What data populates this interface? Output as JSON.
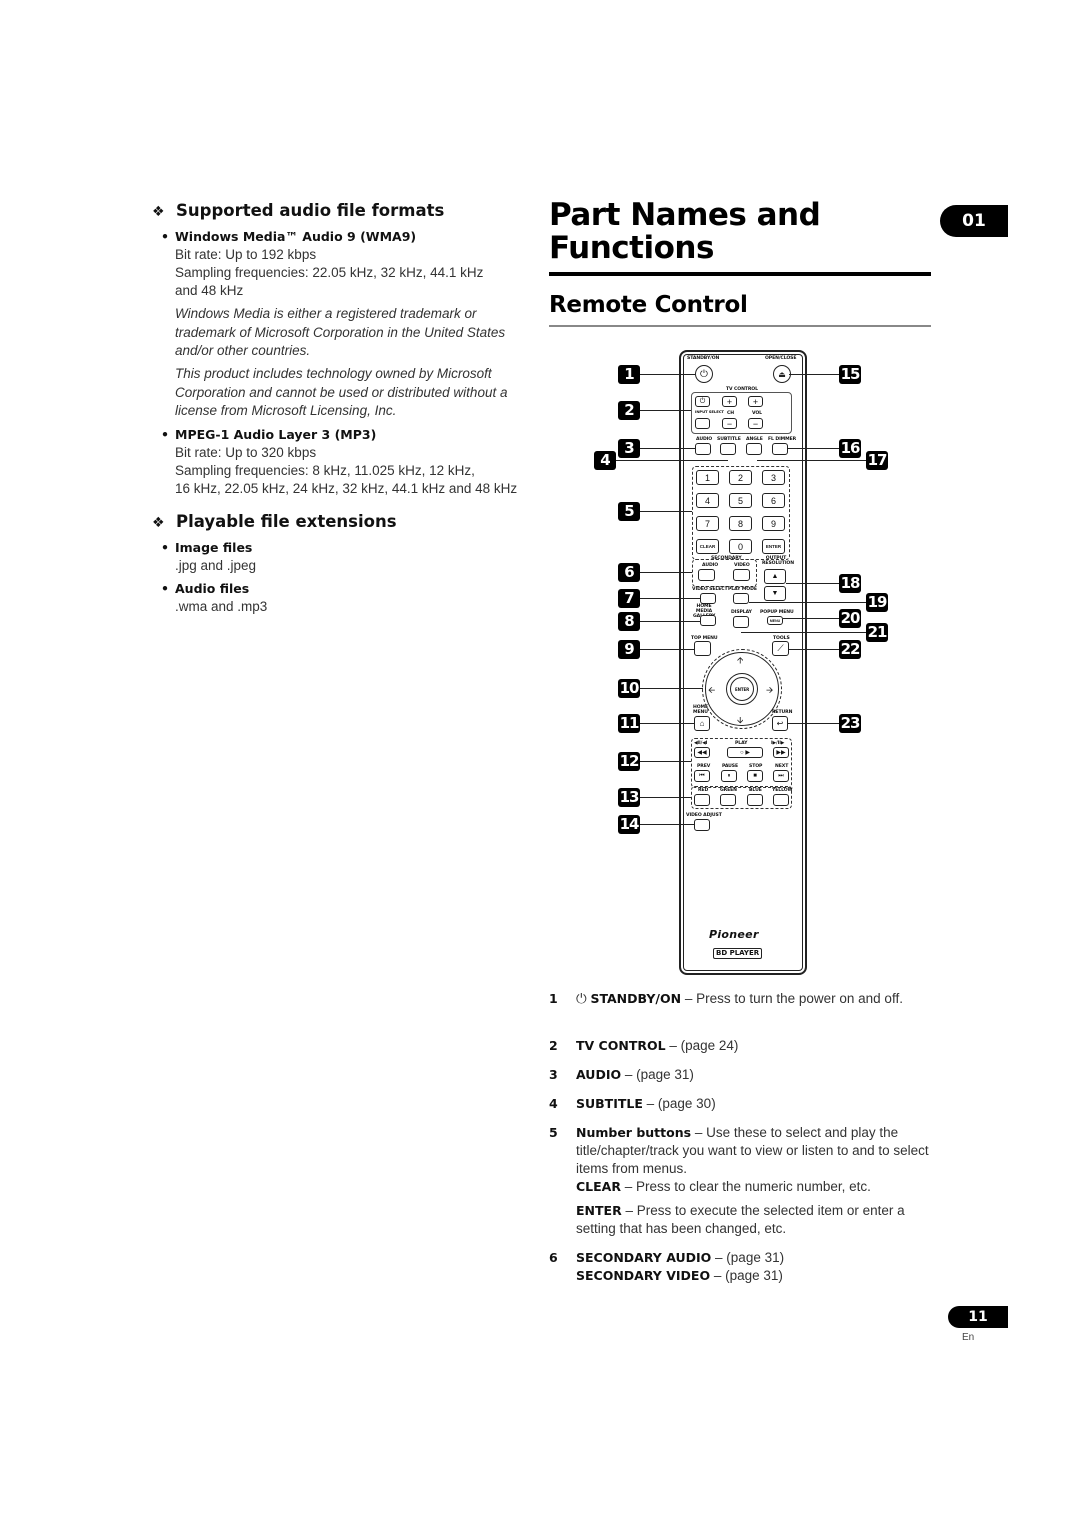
{
  "left": {
    "section1": {
      "heading": "Supported audio file formats",
      "items": [
        {
          "title": "Windows Media™ Audio 9 (WMA9)",
          "lines": [
            "Bit rate: Up to 192 kbps",
            "Sampling frequencies: 22.05 kHz, 32 kHz, 44.1 kHz",
            "and 48 kHz"
          ],
          "notes": [
            "Windows Media is either a registered trademark or trademark of Microsoft Corporation in the United States and/or other countries.",
            "This product includes technology owned by Microsoft Corporation and cannot be used or distributed without a license from Microsoft Licensing, Inc."
          ]
        },
        {
          "title": "MPEG-1 Audio Layer 3 (MP3)",
          "lines": [
            "Bit rate: Up to 320 kbps",
            "Sampling frequencies: 8 kHz, 11.025 kHz, 12 kHz,",
            "16 kHz, 22.05 kHz, 24 kHz, 32 kHz, 44.1 kHz and 48 kHz"
          ]
        }
      ]
    },
    "section2": {
      "heading": "Playable file extensions",
      "items": [
        {
          "title": "Image files",
          "value": ".jpg and .jpeg"
        },
        {
          "title": "Audio files",
          "value": ".wma and .mp3"
        }
      ]
    }
  },
  "right": {
    "title_line1": "Part Names and",
    "title_line2": "Functions",
    "chapter": "01",
    "section": "Remote Control"
  },
  "remote": {
    "labels": {
      "standby": "STANDBY/ON",
      "open_close": "OPEN/CLOSE",
      "tv_control": "TV CONTROL",
      "input_select": "INPUT SELECT",
      "ch": "CH",
      "vol": "VOL",
      "audio": "AUDIO",
      "subtitle": "SUBTITLE",
      "angle": "ANGLE",
      "fl_dimmer": "FL DIMMER",
      "secondary": "SECONDARY",
      "sec_audio": "AUDIO",
      "sec_video": "VIDEO",
      "output_resolution": "OUTPUT RESOLUTION",
      "video_select": "VIDEO SELECT",
      "play_mode": "PLAY MODE",
      "home_media_gallery": "HOME MEDIA GALLERY",
      "display": "DISPLAY",
      "popup_menu": "POPUP MENU",
      "menu": "MENU",
      "top_menu": "TOP MENU",
      "tools": "TOOLS",
      "enter": "ENTER",
      "home_menu": "HOME MENU",
      "return": "RETURN",
      "rev": "◀II/◀I",
      "play": "PLAY",
      "fwd": "I▶/II▶",
      "prev": "PREV",
      "pause": "PAUSE",
      "stop": "STOP",
      "next": "NEXT",
      "red": "RED",
      "green": "GREEN",
      "blue": "BLUE",
      "yellow": "YELLOW",
      "video_adjust": "VIDEO ADJUST",
      "brand": "Pioneer",
      "model": "BD PLAYER"
    },
    "numpad": [
      "1",
      "2",
      "3",
      "4",
      "5",
      "6",
      "7",
      "8",
      "9",
      "CLEAR",
      "0",
      "ENTER"
    ],
    "callouts_left": [
      "1",
      "2",
      "3",
      "4",
      "5",
      "6",
      "7",
      "8",
      "9",
      "10",
      "11",
      "12",
      "13",
      "14"
    ],
    "callouts_right": [
      "15",
      "16",
      "17",
      "18",
      "19",
      "20",
      "21",
      "22",
      "23"
    ]
  },
  "descriptions": [
    {
      "num": "1",
      "icon": "power-icon",
      "term": "STANDBY/ON",
      "text": " – Press to turn the power on and off."
    },
    {
      "num": "2",
      "term": "TV CONTROL",
      "text": " – (page 24)"
    },
    {
      "num": "3",
      "term": "AUDIO",
      "text": " – (page 31)"
    },
    {
      "num": "4",
      "term": "SUBTITLE",
      "text": " – (page 30)"
    },
    {
      "num": "5",
      "term": "Number buttons",
      "text": " – Use these to select and play the title/chapter/track you want to view or listen to and to select items from menus.",
      "sub": [
        {
          "term": "CLEAR",
          "text": " – Press to clear the numeric number, etc."
        },
        {
          "term": "ENTER",
          "text": " – Press to execute the selected item or enter a setting that has been changed, etc."
        }
      ]
    },
    {
      "num": "6",
      "term": "SECONDARY AUDIO",
      "text": " – (page 31)",
      "term2": "SECONDARY VIDEO",
      "text2": " – (page 31)"
    }
  ],
  "footer": {
    "page": "11",
    "lang": "En"
  }
}
